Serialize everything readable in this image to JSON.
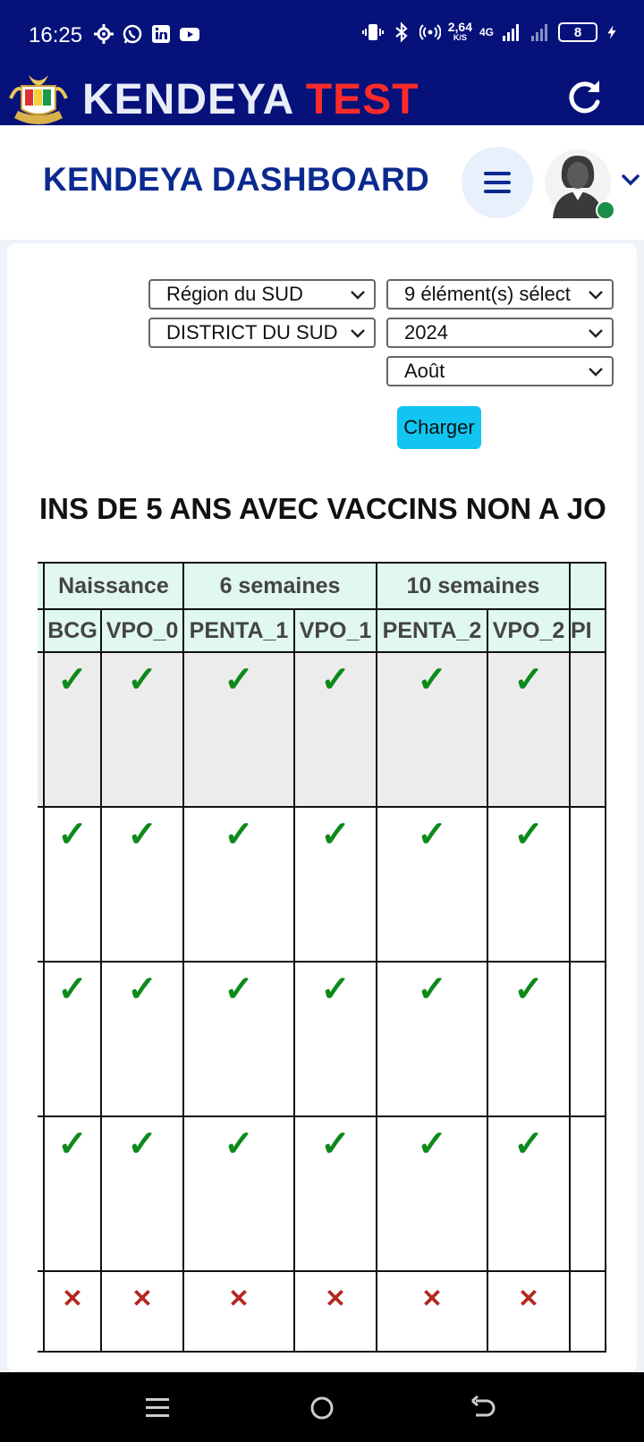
{
  "status_bar": {
    "time": "16:25",
    "left_icons": [
      "settings-icon",
      "whatsapp-icon",
      "linkedin-icon",
      "youtube-icon"
    ],
    "right_icons": [
      "vibrate-icon",
      "bluetooth-icon",
      "hotspot-icon",
      "network-speed",
      "signal-4g-icon",
      "signal-icon",
      "battery-icon",
      "charging-icon"
    ],
    "speed_value": "2,64",
    "speed_unit": "K/S",
    "network": "4G",
    "battery": "8"
  },
  "app_header": {
    "brand_part1": "KENDEYA",
    "brand_part2": "TEST",
    "refresh_icon": "refresh-icon",
    "logo": "guinea-emblem-logo"
  },
  "dashboard": {
    "title": "KENDEYA DASHBOARD",
    "menu_icon": "hamburger-icon",
    "avatar_icon": "user-avatar-icon",
    "online_color": "#1a8f4a"
  },
  "filters": {
    "region": "Région du SUD",
    "elements": "9 élément(s) sélect",
    "district": "DISTRICT DU SUD",
    "year": "2024",
    "month": "Août",
    "load_button": "Charger"
  },
  "section": {
    "title": "INS DE 5 ANS AVEC VACCINS NON A JO"
  },
  "table": {
    "groups": [
      {
        "label": ""
      },
      {
        "label": "Naissance"
      },
      {
        "label": "6 semaines"
      },
      {
        "label": "10 semaines"
      },
      {
        "label": ""
      }
    ],
    "columns": [
      "",
      "BCG",
      "VPO_0",
      "PENTA_1",
      "VPO_1",
      "PENTA_2",
      "VPO_2",
      "PI"
    ],
    "rows": [
      [
        "",
        "✓",
        "✓",
        "✓",
        "✓",
        "✓",
        "✓",
        ""
      ],
      [
        "",
        "✓",
        "✓",
        "✓",
        "✓",
        "✓",
        "✓",
        ""
      ],
      [
        "",
        "✓",
        "✓",
        "✓",
        "✓",
        "✓",
        "✓",
        ""
      ],
      [
        "",
        "✓",
        "✓",
        "✓",
        "✓",
        "✓",
        "✓",
        ""
      ],
      [
        "",
        "✕",
        "✕",
        "✕",
        "✕",
        "✕",
        "✕",
        ""
      ]
    ],
    "colors": {
      "check": "#0d8a1a",
      "cross": "#b3261e",
      "header_bg": "#e0f8ee"
    }
  },
  "nav_bar": {
    "icons": [
      "recents-icon",
      "home-icon",
      "back-icon"
    ]
  },
  "colors": {
    "primary": "#06127a",
    "title": "#0b2a8f",
    "brand_accent": "#ff2a2a",
    "button": "#11c5f0"
  }
}
